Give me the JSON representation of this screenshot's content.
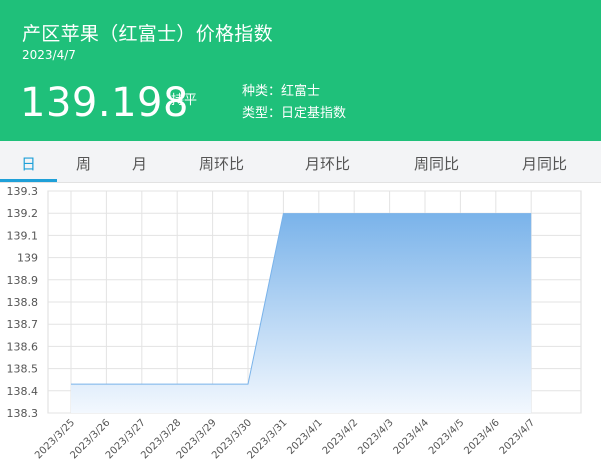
{
  "header": {
    "title": "产区苹果（红富士）价格指数",
    "date": "2023/4/7",
    "price": "139.198",
    "change": "持平",
    "kind": "种类：红富士",
    "type": "类型：日定基指数"
  },
  "tabs": [
    {
      "label": "日",
      "active": true
    },
    {
      "label": "周"
    },
    {
      "label": "月"
    },
    {
      "label": "周环比"
    },
    {
      "label": "月环比"
    },
    {
      "label": "周同比"
    },
    {
      "label": "月同比"
    }
  ],
  "colors": {
    "header_bg": "#1fc07a",
    "accent": "#1fa0d8",
    "area_top": "#7ab3ea",
    "area_bottom": "#f3f8fe",
    "line": "#7ab3ea"
  },
  "chart_data": {
    "type": "area",
    "x": [
      "2023/3/25",
      "2023/3/26",
      "2023/3/27",
      "2023/3/28",
      "2023/3/29",
      "2023/3/30",
      "2023/3/31",
      "2023/4/1",
      "2023/4/2",
      "2023/4/3",
      "2023/4/4",
      "2023/4/5",
      "2023/4/6",
      "2023/4/7"
    ],
    "series": [
      {
        "values": [
          138.43,
          138.43,
          138.43,
          138.43,
          138.43,
          138.43,
          139.198,
          139.198,
          139.198,
          139.198,
          139.198,
          139.198,
          139.198,
          139.198
        ]
      }
    ],
    "yticks": [
      "139.3",
      "139.2",
      "139.1",
      "139",
      "138.9",
      "138.8",
      "138.7",
      "138.6",
      "138.5",
      "138.4",
      "138.3"
    ],
    "ylim": [
      138.3,
      139.3
    ],
    "grid": true,
    "legend": "none"
  }
}
